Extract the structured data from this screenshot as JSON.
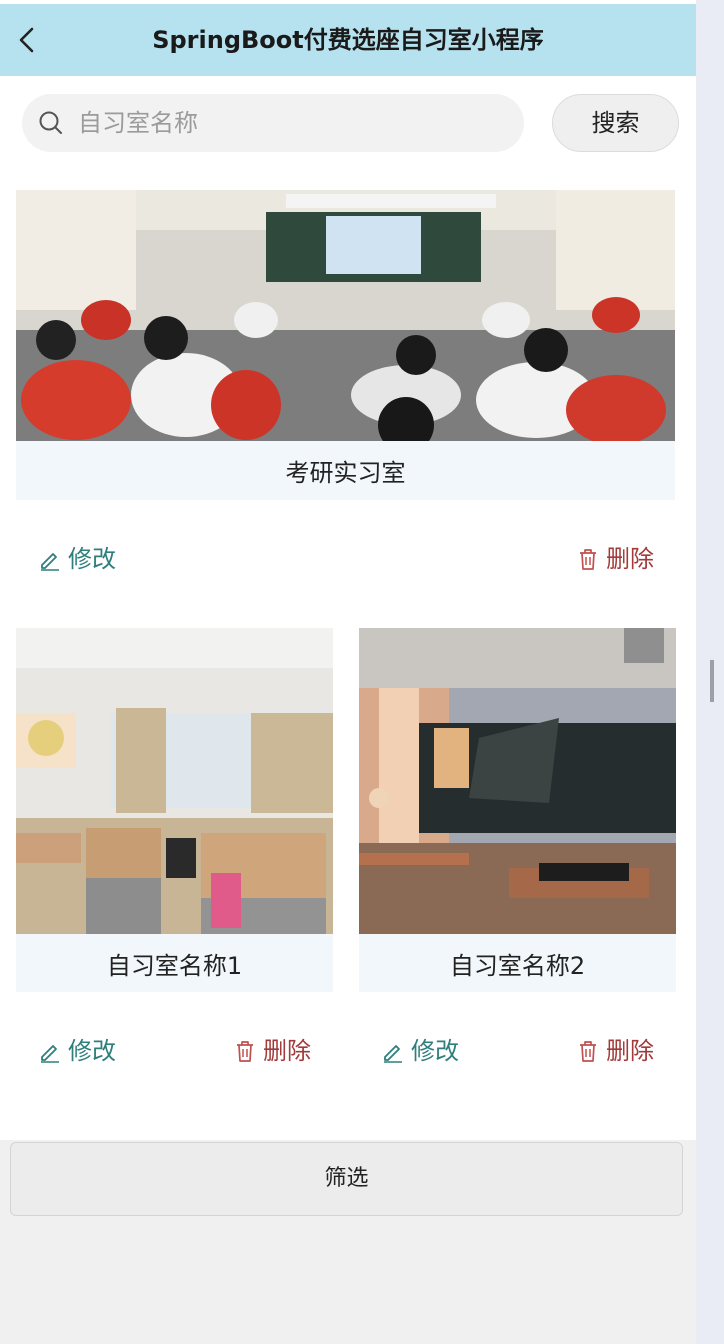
{
  "header": {
    "title": "SpringBoot付费选座自习室小程序"
  },
  "search": {
    "placeholder": "自习室名称",
    "button_label": "搜索"
  },
  "rooms": [
    {
      "name": "考研实习室",
      "edit_label": "修改",
      "delete_label": "删除"
    },
    {
      "name": "自习室名称1",
      "edit_label": "修改",
      "delete_label": "删除"
    },
    {
      "name": "自习室名称2",
      "edit_label": "修改",
      "delete_label": "删除"
    }
  ],
  "filter": {
    "label": "筛选"
  },
  "colors": {
    "header_bg": "#b6e2ef",
    "edit": "#2e7f7c",
    "delete": "#a23a3a",
    "card_caption_bg": "#f1f7fb"
  },
  "icons": {
    "back": "chevron-left-icon",
    "search": "search-icon",
    "edit": "pencil-icon",
    "delete": "trash-icon"
  }
}
